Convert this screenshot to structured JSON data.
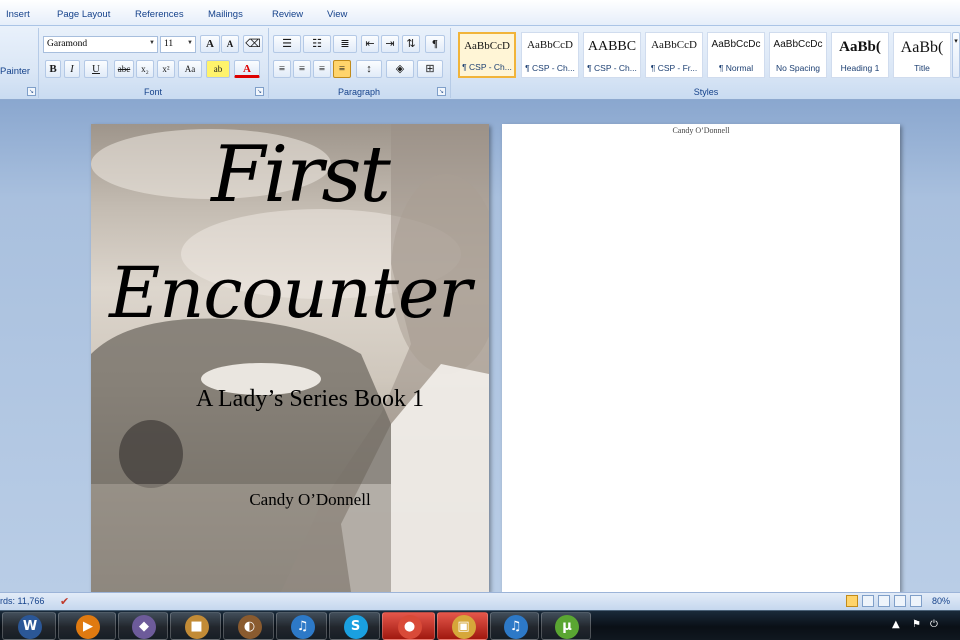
{
  "ribbon": {
    "tabs": [
      "Insert",
      "Page Layout",
      "References",
      "Mailings",
      "Review",
      "View"
    ],
    "clipboard": {
      "format_painter_label": "Painter"
    },
    "font": {
      "group_label": "Font",
      "font_name": "Garamond",
      "font_size": "11",
      "grow_label": "A",
      "shrink_label": "A",
      "bold_label": "B",
      "italic_label": "I",
      "underline_label": "U",
      "strike_label": "abc",
      "subscript_label": "x₂",
      "superscript_label": "x²",
      "case_label": "Aa",
      "highlight_label": "ab",
      "color_label": "A"
    },
    "paragraph": {
      "group_label": "Paragraph",
      "pilcrow_label": "¶"
    },
    "styles": {
      "group_label": "Styles",
      "items": [
        {
          "sample": "AaBbCcD",
          "name": "¶ CSP - Ch..."
        },
        {
          "sample": "AaBbCcD",
          "name": "¶ CSP - Ch..."
        },
        {
          "sample": "AABBC",
          "name": "¶ CSP - Ch..."
        },
        {
          "sample": "AaBbCcD",
          "name": "¶ CSP - Fr..."
        },
        {
          "sample": "AaBbCcDc",
          "name": "¶ Normal"
        },
        {
          "sample": "AaBbCcDc",
          "name": "No Spacing"
        },
        {
          "sample": "AaBb(",
          "name": "Heading 1"
        },
        {
          "sample": "AaBb(",
          "name": "Title"
        }
      ]
    }
  },
  "document": {
    "header_text": "Candy O’Donnell",
    "cover": {
      "title_line1": "First",
      "title_line2": "Encounter",
      "subtitle": "A Lady’s Series Book 1",
      "author": "Candy O’Donnell"
    }
  },
  "statusbar": {
    "words": "rds: 11,766",
    "zoom": "80%"
  },
  "taskbar": {
    "apps": [
      {
        "name": "word",
        "glyph": "W",
        "color": "#2b5797"
      },
      {
        "name": "media",
        "glyph": "▶",
        "color": "#e07a10"
      },
      {
        "name": "app3",
        "glyph": "◆",
        "color": "#6d5b9a"
      },
      {
        "name": "app4",
        "glyph": "■",
        "color": "#c28b36"
      },
      {
        "name": "app5",
        "glyph": "◐",
        "color": "#8a5b2f"
      },
      {
        "name": "itunes",
        "glyph": "♫",
        "color": "#2d79c7"
      },
      {
        "name": "skype",
        "glyph": "S",
        "color": "#1aa0e0"
      },
      {
        "name": "chrome",
        "glyph": "●",
        "color": "#d94a38"
      },
      {
        "name": "app9",
        "glyph": "▣",
        "color": "#d6a73a"
      },
      {
        "name": "itunes2",
        "glyph": "♫",
        "color": "#2d79c7"
      },
      {
        "name": "utorrent",
        "glyph": "µ",
        "color": "#5aa632"
      }
    ],
    "tray_up_label": "▲"
  }
}
